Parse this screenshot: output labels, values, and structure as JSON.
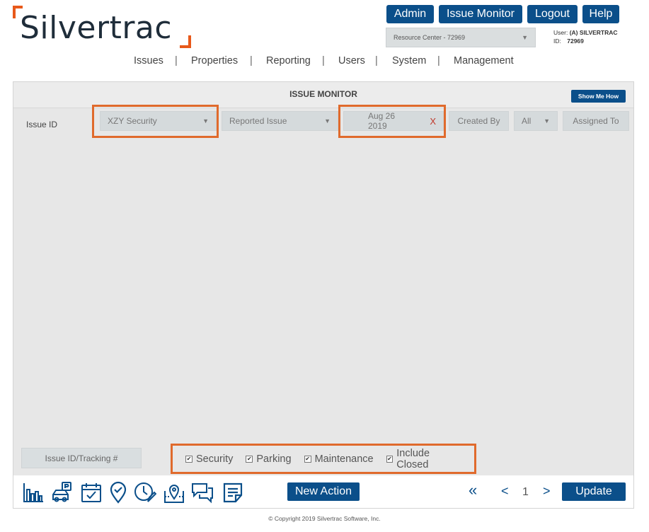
{
  "logo": {
    "text": "Silvertrac"
  },
  "top_buttons": {
    "admin": "Admin",
    "issue_monitor": "Issue Monitor",
    "logout": "Logout",
    "help": "Help"
  },
  "resource_select": {
    "value": "Resource Center - 72969"
  },
  "user": {
    "user_label": "User:",
    "user_value": "(A) SILVERTRAC",
    "id_label": "ID:",
    "id_value": "72969"
  },
  "nav": {
    "items": [
      "Issues",
      "Properties",
      "Reporting",
      "Users",
      "System",
      "Management"
    ],
    "separator": "|"
  },
  "panel": {
    "title": "ISSUE MONITOR",
    "show_me_how": "Show Me How"
  },
  "filters": {
    "issue_id_label": "Issue ID",
    "company": "XZY Security",
    "issue_type": "Reported Issue",
    "date": "Aug 26 2019",
    "date_clear": "X",
    "created_by": "Created By",
    "all": "All",
    "assigned_to": "Assigned To"
  },
  "bottom": {
    "tracking_placeholder": "Issue ID/Tracking #",
    "checkboxes": [
      {
        "label": "Security",
        "checked": true
      },
      {
        "label": "Parking",
        "checked": true
      },
      {
        "label": "Maintenance",
        "checked": true
      },
      {
        "label": "Include Closed",
        "checked": true
      }
    ]
  },
  "toolbar": {
    "icons": [
      "bar-chart-icon",
      "parking-car-icon",
      "calendar-check-icon",
      "location-pin-icon",
      "clock-edit-icon",
      "map-pin-icon",
      "chat-bubbles-icon",
      "notes-icon"
    ],
    "new_action": "New Action",
    "first_page": "«",
    "prev_page": "<",
    "page": "1",
    "next_page": ">",
    "update": "Update"
  },
  "footer": {
    "copyright": "© Copyright 2019 Silvertrac Software, Inc."
  },
  "colors": {
    "brand_blue": "#0b4f8a",
    "accent_orange": "#e06a2c",
    "panel_gray": "#e7e7e7"
  }
}
